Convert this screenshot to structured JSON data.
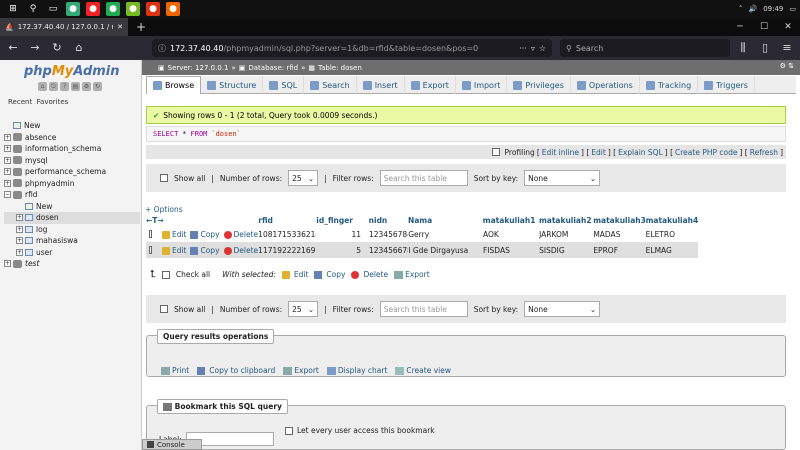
{
  "taskbar": {
    "time": "09:49",
    "tray_lang": "ENG"
  },
  "browser": {
    "tab_title": "172.37.40.40 / 127.0.0.1 / rfid / d",
    "url_host": "172.37.40.40",
    "url_path": "/phpmyadmin/sql.php?server=1&db=rfid&table=dosen&pos=0",
    "search_placeholder": "Search"
  },
  "sidebar": {
    "logo_php": "php",
    "logo_my": "My",
    "logo_admin": "Admin",
    "recent": "Recent",
    "favorites": "Favorites",
    "tree": [
      {
        "label": "New",
        "level": 0,
        "type": "new"
      },
      {
        "label": "absence",
        "level": 0,
        "type": "db"
      },
      {
        "label": "information_schema",
        "level": 0,
        "type": "db"
      },
      {
        "label": "mysql",
        "level": 0,
        "type": "db"
      },
      {
        "label": "performance_schema",
        "level": 0,
        "type": "db"
      },
      {
        "label": "phpmyadmin",
        "level": 0,
        "type": "db"
      },
      {
        "label": "rfid",
        "level": 0,
        "type": "db-open"
      },
      {
        "label": "New",
        "level": 1,
        "type": "new"
      },
      {
        "label": "dosen",
        "level": 1,
        "type": "table-sel"
      },
      {
        "label": "log",
        "level": 1,
        "type": "table"
      },
      {
        "label": "mahasiswa",
        "level": 1,
        "type": "table"
      },
      {
        "label": "user",
        "level": 1,
        "type": "table"
      },
      {
        "label": "test",
        "level": 0,
        "type": "db-italic"
      }
    ]
  },
  "breadcrumb": {
    "server": "Server: 127.0.0.1",
    "database": "Database: rfid",
    "table": "Table: dosen"
  },
  "tabs": [
    "Browse",
    "Structure",
    "SQL",
    "Search",
    "Insert",
    "Export",
    "Import",
    "Privileges",
    "Operations",
    "Tracking",
    "Triggers"
  ],
  "result": {
    "message": "Showing rows 0 - 1 (2 total, Query took 0.0009 seconds.)",
    "sql_select": "SELECT",
    "sql_star": "*",
    "sql_from": "FROM",
    "sql_table": "`dosen`"
  },
  "profiling": {
    "label": "Profiling",
    "links": [
      "Edit inline",
      "Edit",
      "Explain SQL",
      "Create PHP code",
      "Refresh"
    ]
  },
  "nav": {
    "show_all": "Show all",
    "rows_label": "Number of rows:",
    "rows_value": "25",
    "filter_label": "Filter rows:",
    "filter_placeholder": "Search this table",
    "sort_label": "Sort by key:",
    "sort_value": "None"
  },
  "options_link": "+ Options",
  "table": {
    "columns": [
      "rfid",
      "id_finger",
      "nidn",
      "Nama",
      "matakuliah1",
      "matakuliah2",
      "matakuliah3",
      "matakuliah4"
    ],
    "actions": {
      "edit": "Edit",
      "copy": "Copy",
      "delete": "Delete"
    },
    "rows": [
      [
        "1081715336214",
        "11",
        "123456784",
        "Gerry",
        "AOK",
        "JARKOM",
        "MADAS",
        "ELETRO"
      ],
      [
        "117192222169194",
        "5",
        "123456678",
        "I Gde Dirgayusa",
        "FISDAS",
        "SISDIG",
        "EPROF",
        "ELMAG"
      ]
    ]
  },
  "bulk": {
    "check_all": "Check all",
    "with_selected": "With selected:",
    "edit": "Edit",
    "copy": "Copy",
    "delete": "Delete",
    "export": "Export"
  },
  "qro": {
    "legend": "Query results operations",
    "print": "Print",
    "copy_clipboard": "Copy to clipboard",
    "export": "Export",
    "display_chart": "Display chart",
    "create_view": "Create view"
  },
  "bookmark": {
    "legend": "Bookmark this SQL query",
    "label": "Label:",
    "every_user": "Let every user access this bookmark"
  },
  "console": "Console"
}
